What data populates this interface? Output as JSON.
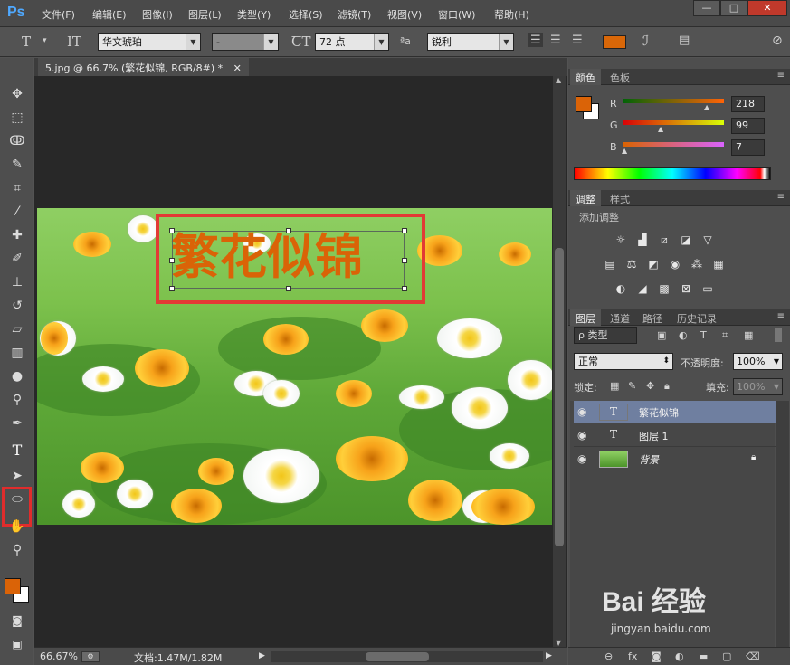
{
  "app": {
    "logo": "Ps"
  },
  "menu": [
    "文件(F)",
    "编辑(E)",
    "图像(I)",
    "图层(L)",
    "类型(Y)",
    "选择(S)",
    "滤镜(T)",
    "视图(V)",
    "窗口(W)",
    "帮助(H)"
  ],
  "window_controls": {
    "minimize": "—",
    "restore": "□",
    "close": "✕"
  },
  "options": {
    "font_family": "华文琥珀",
    "font_style": "-",
    "font_size": "72 点",
    "aa_label": "ªa",
    "anti_alias": "锐利",
    "text_color": "#d96708"
  },
  "document": {
    "tab_title": "5.jpg @ 66.7% (繁花似锦, RGB/8#) *",
    "canvas_text": "繁花似锦",
    "zoom": "66.67%",
    "doc_info": "文档:1.47M/1.82M"
  },
  "color_panel": {
    "tabs": [
      "颜色",
      "色板"
    ],
    "r_label": "R",
    "r_value": "218",
    "g_label": "G",
    "g_value": "99",
    "b_label": "B",
    "b_value": "7",
    "foreground": "#da6307"
  },
  "adjust_panel": {
    "tabs": [
      "调整",
      "样式"
    ],
    "title": "添加调整"
  },
  "layers_panel": {
    "tabs": [
      "图层",
      "通道",
      "路径",
      "历史记录"
    ],
    "filter_kind": "ρ 类型",
    "blend_mode": "正常",
    "opacity_label": "不透明度:",
    "opacity_value": "100%",
    "lock_label": "锁定:",
    "fill_label": "填充:",
    "fill_value": "100%",
    "layers": [
      {
        "name": "繁花似锦",
        "kind": "T"
      },
      {
        "name": "图层 1",
        "kind": "T"
      },
      {
        "name": "背景",
        "kind": "image"
      }
    ]
  },
  "watermark": {
    "brand": "Bai 经验",
    "url": "jingyan.baidu.com"
  }
}
